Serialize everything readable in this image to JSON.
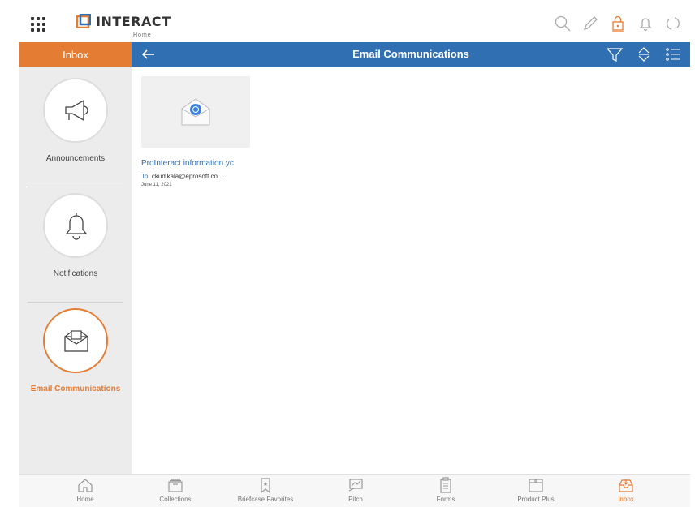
{
  "app": {
    "logo_text": "INTERACT",
    "logo_sub": "Home",
    "accent": "#e47c34",
    "primary": "#2f6fb2"
  },
  "header": {
    "left_tab": "Inbox",
    "title": "Email Communications"
  },
  "sidebar": {
    "items": [
      {
        "label": "Announcements",
        "icon": "megaphone-icon"
      },
      {
        "label": "Notifications",
        "icon": "bell-icon"
      },
      {
        "label": "Email Communications",
        "icon": "mail-tray-icon",
        "active": true
      }
    ]
  },
  "content": {
    "cards": [
      {
        "title": "ProInteract information yc",
        "to_label": "To:",
        "to_value": "ckudikala@eprosoft.co...",
        "date": "June 11, 2021"
      }
    ]
  },
  "bottom_nav": {
    "items": [
      {
        "label": "Home",
        "icon": "home-icon"
      },
      {
        "label": "Collections",
        "icon": "collections-icon"
      },
      {
        "label": "Briefcase Favorites",
        "icon": "bookmark-icon"
      },
      {
        "label": "Pitch",
        "icon": "pitch-icon"
      },
      {
        "label": "Forms",
        "icon": "clipboard-icon"
      },
      {
        "label": "Product Plus",
        "icon": "product-box-icon"
      },
      {
        "label": "Inbox",
        "icon": "inbox-icon",
        "active": true
      }
    ]
  }
}
